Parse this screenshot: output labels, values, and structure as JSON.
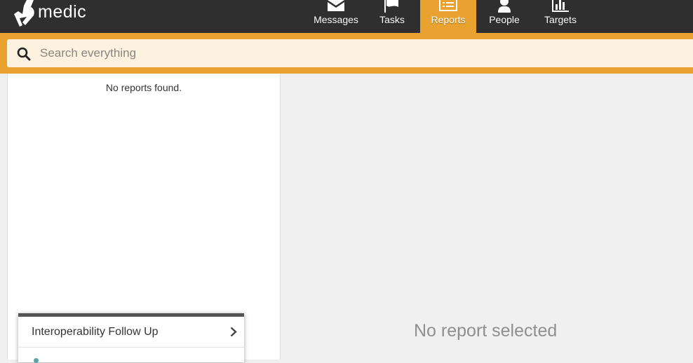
{
  "app": {
    "logo_text": "medic"
  },
  "nav": {
    "items": [
      {
        "label": "Messages",
        "icon": "envelope-icon",
        "active": false
      },
      {
        "label": "Tasks",
        "icon": "flag-icon",
        "active": false
      },
      {
        "label": "Reports",
        "icon": "list-icon",
        "active": true
      },
      {
        "label": "People",
        "icon": "person-icon",
        "active": false
      },
      {
        "label": "Targets",
        "icon": "bar-chart-icon",
        "active": false
      }
    ]
  },
  "search": {
    "placeholder": "Search everything",
    "value": ""
  },
  "reports_list": {
    "empty_text": "No reports found."
  },
  "popup_menu": {
    "items": [
      {
        "label": "Interoperability Follow Up"
      }
    ]
  },
  "detail": {
    "empty_text": "No report selected"
  },
  "colors": {
    "header_bg": "#2f2f2f",
    "accent": "#e9a22f",
    "search_bg": "#fdf1e0",
    "panel_bg": "#f0f0f0"
  }
}
